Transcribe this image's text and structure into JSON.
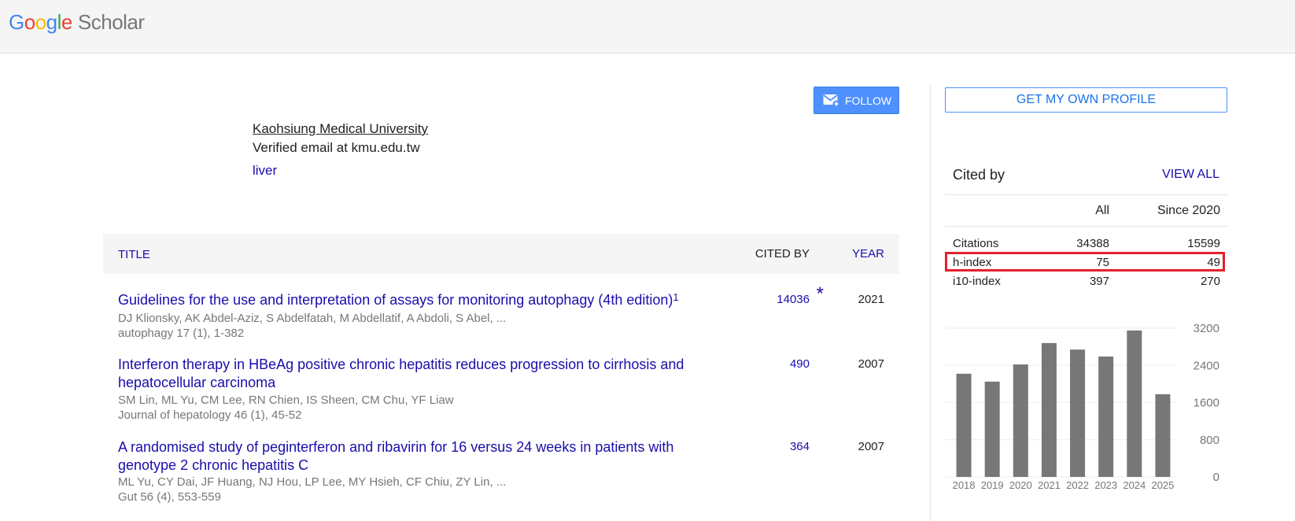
{
  "header": {
    "logo_letters": [
      "G",
      "o",
      "o",
      "g",
      "l",
      "e"
    ],
    "logo_suffix": "Scholar"
  },
  "profile": {
    "follow_label": "FOLLOW",
    "affiliation": "Kaohsiung Medical University",
    "email": "Verified email at kmu.edu.tw",
    "interests": [
      "liver"
    ]
  },
  "table": {
    "headers": {
      "title": "TITLE",
      "cited_by": "CITED BY",
      "year": "YEAR"
    },
    "rows": [
      {
        "title": "Guidelines for the use and interpretation of assays for monitoring autophagy (4th edition)",
        "sup": "1",
        "authors": "DJ Klionsky, AK Abdel-Aziz, S Abdelfatah, M Abdellatif, A Abdoli, S Abel, ...",
        "venue": "autophagy 17 (1), 1-382",
        "cited": "14036",
        "star": "*",
        "year": "2021"
      },
      {
        "title": "Interferon therapy in HBeAg positive chronic hepatitis reduces progression to cirrhosis and hepatocellular carcinoma",
        "authors": "SM Lin, ML Yu, CM Lee, RN Chien, IS Sheen, CM Chu, YF Liaw",
        "venue": "Journal of hepatology 46 (1), 45-52",
        "cited": "490",
        "year": "2007"
      },
      {
        "title": "A randomised study of peginterferon and ribavirin for 16 versus 24 weeks in patients with genotype 2 chronic hepatitis C",
        "authors": "ML Yu, CY Dai, JF Huang, NJ Hou, LP Lee, MY Hsieh, CF Chiu, ZY Lin, ...",
        "venue": "Gut 56 (4), 553-559",
        "cited": "364",
        "year": "2007"
      }
    ]
  },
  "sidebar": {
    "own_profile_label": "GET MY OWN PROFILE",
    "cited_by_label": "Cited by",
    "view_all_label": "VIEW ALL",
    "stats": {
      "col_all": "All",
      "col_since": "Since 2020",
      "rows": [
        {
          "label": "Citations",
          "all": "34388",
          "since": "15599"
        },
        {
          "label": "h-index",
          "all": "75",
          "since": "49",
          "highlighted": true
        },
        {
          "label": "i10-index",
          "all": "397",
          "since": "270"
        }
      ]
    }
  },
  "colors": {
    "link": "#1a0dab",
    "accent": "#4d90fe",
    "highlight": "#e5202a",
    "bar": "#777777"
  },
  "chart_data": {
    "type": "bar",
    "categories": [
      "2018",
      "2019",
      "2020",
      "2021",
      "2022",
      "2023",
      "2024",
      "2025"
    ],
    "values": [
      2220,
      2050,
      2420,
      2880,
      2740,
      2590,
      3150,
      1780
    ],
    "yticks": [
      "3200",
      "2400",
      "1600",
      "800",
      "0"
    ],
    "ylim": [
      0,
      3200
    ],
    "grid": true
  }
}
